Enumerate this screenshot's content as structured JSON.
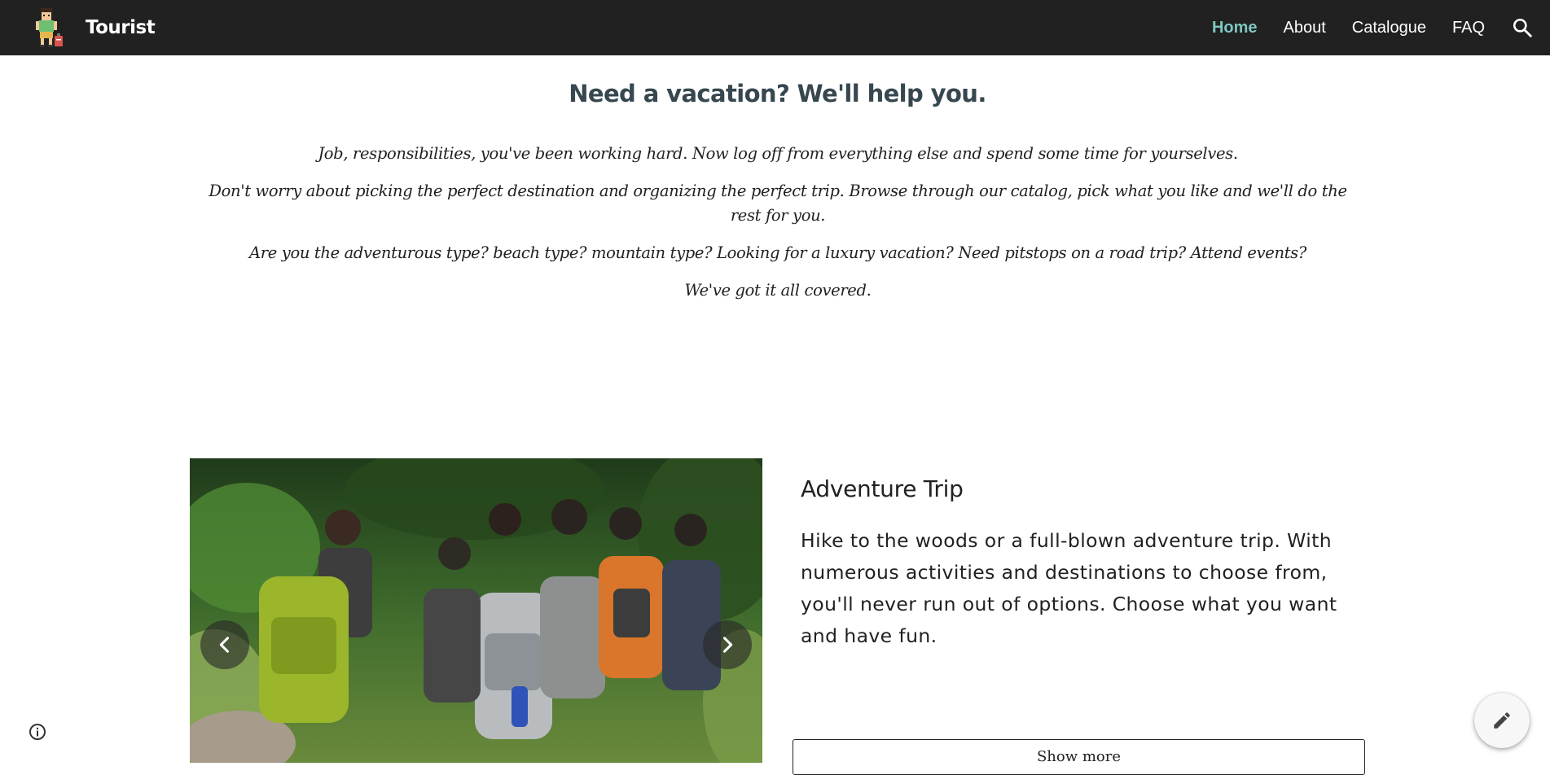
{
  "header": {
    "site_title": "Tourist",
    "logo_icon": "tourist-figure-icon",
    "background_color": "#212121",
    "nav": [
      {
        "label": "Home",
        "active": true
      },
      {
        "label": "About",
        "active": false
      },
      {
        "label": "Catalogue",
        "active": false
      },
      {
        "label": "FAQ",
        "active": false
      }
    ],
    "active_color": "#7fc6c1",
    "search_icon": "search-icon"
  },
  "intro": {
    "heading": "Need a vacation? We'll help you.",
    "paragraphs": [
      "Job, responsibilities, you've been working hard. Now log off from everything else and spend some time for yourselves.",
      "Don't worry about picking the perfect destination and organizing the perfect trip. Browse through our catalog, pick what you like and we'll do the rest for you.",
      "Are you the adventurous type? beach type? mountain type?  Looking for a luxury vacation? Need pitstops on a road trip?  Attend events?",
      "We've got it all covered."
    ]
  },
  "feature": {
    "title": "Adventure Trip",
    "description": "Hike to the woods or a full-blown adventure trip. With numerous activities and destinations to choose from, you'll never run out of options. Choose what you want and have fun.",
    "button_label": "Show more",
    "carousel": {
      "prev_icon": "chevron-left-icon",
      "next_icon": "chevron-right-icon"
    }
  },
  "floating": {
    "info_icon": "info-icon",
    "edit_icon": "pencil-icon"
  }
}
